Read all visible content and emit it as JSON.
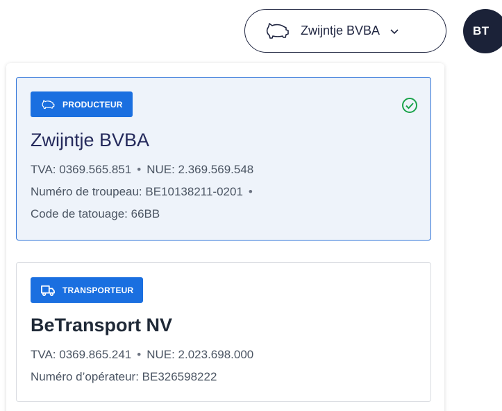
{
  "header": {
    "company_name": "Zwijntje BVBA",
    "company_icon": "pig-icon",
    "avatar_initials": "BT"
  },
  "companies": [
    {
      "badge_label": "PRODUCTEUR",
      "badge_icon": "pig-icon",
      "name": "Zwijntje BVBA",
      "selected": true,
      "tva": "TVA: 0369.565.851",
      "nue": "NUE: 2.369.569.548",
      "herd_number": "Numéro de troupeau: BE10138211-0201",
      "tattoo_code": "Code de tatouage: 66BB"
    },
    {
      "badge_label": "TRANSPORTEUR",
      "badge_icon": "truck-icon",
      "name": "BeTransport NV",
      "selected": false,
      "tva": "TVA: 0369.865.241",
      "nue": "NUE: 2.023.698.000",
      "operator_number": "Numéro d’opérateur: BE326598222"
    }
  ],
  "separator": "•",
  "colors": {
    "badge_blue": "#1a6fe0",
    "selected_border": "#2e73d8",
    "selected_bg": "#eef3fa",
    "check_green": "#1aa34a",
    "navy": "#1b2238"
  }
}
